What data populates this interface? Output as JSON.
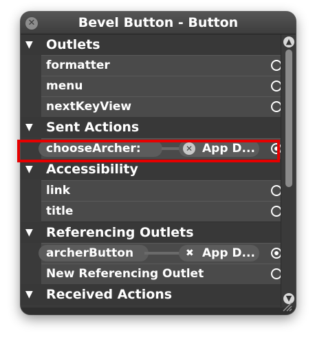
{
  "window": {
    "title": "Bevel Button - Button"
  },
  "sections": {
    "outlets": "Outlets",
    "sent_actions": "Sent Actions",
    "accessibility": "Accessibility",
    "referencing_outlets": "Referencing Outlets",
    "received_actions": "Received Actions"
  },
  "outlets": [
    "formatter",
    "menu",
    "nextKeyView"
  ],
  "sent_action": {
    "name": "chooseArcher:",
    "target": "App D..."
  },
  "accessibility": [
    "link",
    "title"
  ],
  "referencing_outlet": {
    "name": "archerButton",
    "target": "App D..."
  },
  "new_referencing_outlet": "New Referencing Outlet",
  "icons": {
    "close": "close-icon",
    "disclosure": "disclosure-triangle-icon",
    "connection": "connection-circle-icon",
    "scroll_up": "scroll-up-arrow-icon",
    "scroll_down": "scroll-down-arrow-icon",
    "resize": "resize-grip-icon"
  },
  "colors": {
    "panel": "#3a3a3a",
    "row": "#4a4a4a",
    "highlight": "#e60000"
  }
}
